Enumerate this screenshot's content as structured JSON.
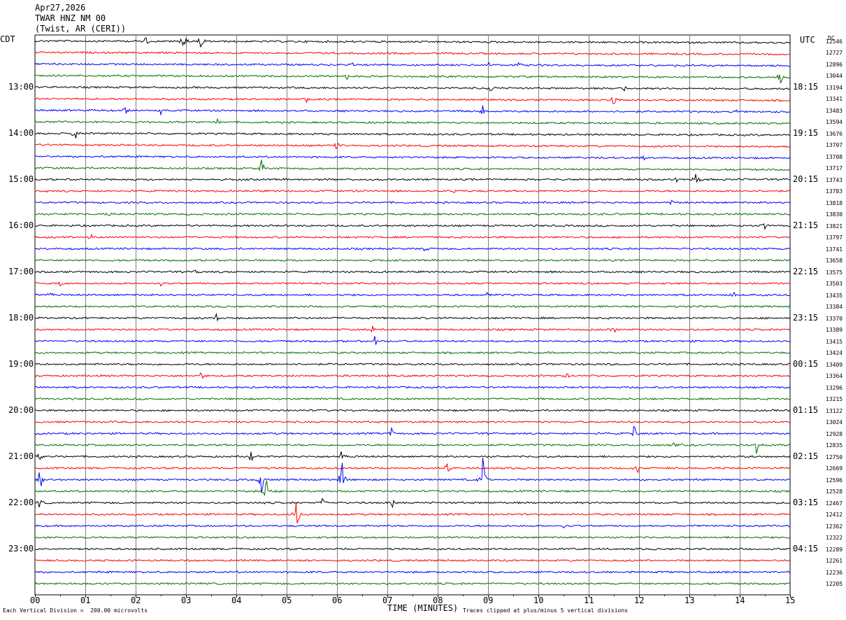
{
  "header": {
    "date": "Apr27,2026",
    "station": "TWAR HNZ NM 00",
    "location": "(Twist, AR (CERI))"
  },
  "axes": {
    "left_tz": "CDT",
    "right_tz": "UTC",
    "dc_label": "DC"
  },
  "footer": {
    "vertical_division": "Each Vertical Division =  200.00 microvolts",
    "clipping": "Traces clipped at plus/minus 5 vertical divisions"
  },
  "colors": {
    "trace_cycle": [
      "#000000",
      "#ff0000",
      "#0000ff",
      "#007000"
    ],
    "grid": "#808080"
  },
  "chart_data": {
    "type": "line",
    "title": "",
    "xlabel": "TIME (MINUTES)",
    "ylabel": "",
    "xlim": [
      0,
      15
    ],
    "x_ticks": [
      "00",
      "01",
      "02",
      "03",
      "04",
      "05",
      "06",
      "07",
      "08",
      "09",
      "10",
      "11",
      "12",
      "13",
      "14",
      "15"
    ],
    "grid": true,
    "trace_count": 48,
    "left_hour_labels": [
      {
        "row": 4,
        "label": "13:00"
      },
      {
        "row": 8,
        "label": "14:00"
      },
      {
        "row": 12,
        "label": "15:00"
      },
      {
        "row": 16,
        "label": "16:00"
      },
      {
        "row": 20,
        "label": "17:00"
      },
      {
        "row": 24,
        "label": "18:00"
      },
      {
        "row": 28,
        "label": "19:00"
      },
      {
        "row": 32,
        "label": "20:00"
      },
      {
        "row": 36,
        "label": "21:00"
      },
      {
        "row": 40,
        "label": "22:00"
      },
      {
        "row": 44,
        "label": "23:00"
      }
    ],
    "right_hour_labels": [
      {
        "row": 4,
        "label": "18:15"
      },
      {
        "row": 8,
        "label": "19:15"
      },
      {
        "row": 12,
        "label": "20:15"
      },
      {
        "row": 16,
        "label": "21:15"
      },
      {
        "row": 20,
        "label": "22:15"
      },
      {
        "row": 24,
        "label": "23:15"
      },
      {
        "row": 28,
        "label": "00:15"
      },
      {
        "row": 32,
        "label": "01:15"
      },
      {
        "row": 36,
        "label": "02:15"
      },
      {
        "row": 40,
        "label": "03:15"
      },
      {
        "row": 44,
        "label": "04:15"
      }
    ],
    "dc_values": [
      "12546",
      "12727",
      "12896",
      "13044",
      "13194",
      "13341",
      "13483",
      "13594",
      "13676",
      "13707",
      "13708",
      "13717",
      "13743",
      "13783",
      "13818",
      "13830",
      "13821",
      "13797",
      "13741",
      "13658",
      "13575",
      "13503",
      "13435",
      "13384",
      "13370",
      "13389",
      "13415",
      "13424",
      "13409",
      "13364",
      "13296",
      "13215",
      "13122",
      "13024",
      "12928",
      "12835",
      "12750",
      "12669",
      "12596",
      "12528",
      "12467",
      "12412",
      "12362",
      "12322",
      "12289",
      "12261",
      "12236",
      "12205"
    ],
    "events": [
      {
        "row": 0,
        "minute": 2.2,
        "amp": 9
      },
      {
        "row": 0,
        "minute": 2.95,
        "amp": 18
      },
      {
        "row": 0,
        "minute": 3.3,
        "amp": 16
      },
      {
        "row": 2,
        "minute": 6.3,
        "amp": 5
      },
      {
        "row": 2,
        "minute": 9.0,
        "amp": 6
      },
      {
        "row": 2,
        "minute": 9.6,
        "amp": 5
      },
      {
        "row": 3,
        "minute": 6.2,
        "amp": 6
      },
      {
        "row": 3,
        "minute": 14.8,
        "amp": 12
      },
      {
        "row": 4,
        "minute": 9.05,
        "amp": 8
      },
      {
        "row": 4,
        "minute": 11.7,
        "amp": 6
      },
      {
        "row": 5,
        "minute": 5.4,
        "amp": 7
      },
      {
        "row": 5,
        "minute": 11.5,
        "amp": 12
      },
      {
        "row": 6,
        "minute": 1.8,
        "amp": 9
      },
      {
        "row": 6,
        "minute": 2.5,
        "amp": 6
      },
      {
        "row": 6,
        "minute": 8.9,
        "amp": 9
      },
      {
        "row": 6,
        "minute": 13.9,
        "amp": 7
      },
      {
        "row": 7,
        "minute": 3.6,
        "amp": 8
      },
      {
        "row": 8,
        "minute": 0.8,
        "amp": 12
      },
      {
        "row": 9,
        "minute": 6.0,
        "amp": 12
      },
      {
        "row": 10,
        "minute": 12.1,
        "amp": 5
      },
      {
        "row": 11,
        "minute": 4.5,
        "amp": 14
      },
      {
        "row": 12,
        "minute": 13.15,
        "amp": 20
      },
      {
        "row": 12,
        "minute": 12.75,
        "amp": 6
      },
      {
        "row": 13,
        "minute": 8.35,
        "amp": 8
      },
      {
        "row": 14,
        "minute": 12.65,
        "amp": 5
      },
      {
        "row": 15,
        "minute": 1.5,
        "amp": 4
      },
      {
        "row": 16,
        "minute": 14.5,
        "amp": 6
      },
      {
        "row": 17,
        "minute": 1.1,
        "amp": 9
      },
      {
        "row": 18,
        "minute": 7.75,
        "amp": 8
      },
      {
        "row": 20,
        "minute": 3.2,
        "amp": 5
      },
      {
        "row": 21,
        "minute": 0.5,
        "amp": 6
      },
      {
        "row": 21,
        "minute": 2.5,
        "amp": 5
      },
      {
        "row": 22,
        "minute": 0.3,
        "amp": 6
      },
      {
        "row": 22,
        "minute": 9.0,
        "amp": 6
      },
      {
        "row": 22,
        "minute": 13.9,
        "amp": 6
      },
      {
        "row": 24,
        "minute": 3.6,
        "amp": 8
      },
      {
        "row": 25,
        "minute": 6.7,
        "amp": 8
      },
      {
        "row": 25,
        "minute": 11.5,
        "amp": 7
      },
      {
        "row": 26,
        "minute": 6.75,
        "amp": 9
      },
      {
        "row": 28,
        "minute": 0.3,
        "amp": 4
      },
      {
        "row": 29,
        "minute": 3.3,
        "amp": 7
      },
      {
        "row": 29,
        "minute": 10.55,
        "amp": 11
      },
      {
        "row": 34,
        "minute": 7.1,
        "amp": 13
      },
      {
        "row": 34,
        "minute": 11.9,
        "amp": 13
      },
      {
        "row": 35,
        "minute": 14.35,
        "amp": 22
      },
      {
        "row": 35,
        "minute": 12.7,
        "amp": 8
      },
      {
        "row": 36,
        "minute": 0.1,
        "amp": 12
      },
      {
        "row": 36,
        "minute": 4.3,
        "amp": 10
      },
      {
        "row": 36,
        "minute": 6.1,
        "amp": 12
      },
      {
        "row": 37,
        "minute": 8.2,
        "amp": 12
      },
      {
        "row": 37,
        "minute": 11.95,
        "amp": 13
      },
      {
        "row": 38,
        "minute": 0.1,
        "amp": 22
      },
      {
        "row": 38,
        "minute": 4.5,
        "amp": 25
      },
      {
        "row": 38,
        "minute": 6.1,
        "amp": 30
      },
      {
        "row": 38,
        "minute": 8.9,
        "amp": 40
      },
      {
        "row": 39,
        "minute": 4.6,
        "amp": 20
      },
      {
        "row": 40,
        "minute": 0.1,
        "amp": 12
      },
      {
        "row": 40,
        "minute": 5.7,
        "amp": 8
      },
      {
        "row": 40,
        "minute": 7.1,
        "amp": 8
      },
      {
        "row": 41,
        "minute": 5.2,
        "amp": 30
      },
      {
        "row": 42,
        "minute": 10.5,
        "amp": 4
      }
    ]
  }
}
